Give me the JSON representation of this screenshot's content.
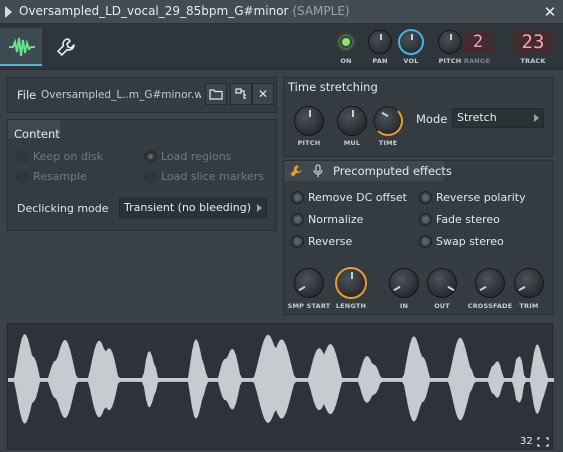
{
  "titlebar": {
    "title": "Oversampled_LD_vocal_29_85bpm_G#minor",
    "tag": "(SAMPLE)"
  },
  "toolbar": {
    "on_label": "ON",
    "pan_label": "PAN",
    "vol_label": "VOL",
    "pitch_label": "PITCH",
    "range_label": "RANGE",
    "range_value": "2",
    "track_label": "TRACK",
    "track_value": "23",
    "led_color": "#8ee65c",
    "accent": "#41b4e4"
  },
  "file": {
    "label": "File",
    "name": "Oversampled_L..m_G#minor.wav"
  },
  "content": {
    "heading": "Content",
    "options": {
      "keep_on_disk": "Keep on disk",
      "resample": "Resample",
      "load_regions": "Load regions",
      "load_slice_markers": "Load slice markers"
    },
    "declicking_label": "Declicking mode",
    "declicking_value": "Transient (no bleeding)"
  },
  "time_stretching": {
    "heading": "Time stretching",
    "knobs": {
      "pitch": "PITCH",
      "mul": "MUL",
      "time": "TIME"
    },
    "mode_label": "Mode",
    "mode_value": "Stretch"
  },
  "precomputed": {
    "heading": "Precomputed effects",
    "effects": {
      "remove_dc": "Remove DC offset",
      "normalize": "Normalize",
      "reverse": "Reverse",
      "reverse_polarity": "Reverse polarity",
      "fade_stereo": "Fade stereo",
      "swap_stereo": "Swap stereo"
    },
    "knobs": {
      "smp_start": "SMP START",
      "length": "LENGTH",
      "in": "IN",
      "out": "OUT",
      "crossfade": "CROSSFADE",
      "trim": "TRIM"
    }
  },
  "waveform": {
    "zoom": "32"
  }
}
